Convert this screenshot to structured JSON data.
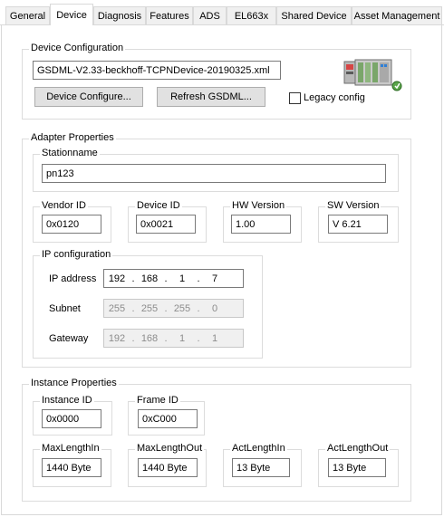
{
  "tabs": [
    {
      "label": "General"
    },
    {
      "label": "Device"
    },
    {
      "label": "Diagnosis"
    },
    {
      "label": "Features"
    },
    {
      "label": "ADS"
    },
    {
      "label": "EL663x"
    },
    {
      "label": "Shared Device"
    },
    {
      "label": "Asset Management"
    }
  ],
  "active_tab": "Device",
  "device_config": {
    "title": "Device Configuration",
    "gsdml_file": "GSDML-V2.33-beckhoff-TCPNDevice-20190325.xml",
    "device_configure_label": "Device Configure...",
    "refresh_gsdml_label": "Refresh GSDML...",
    "legacy_config_label": "Legacy config",
    "legacy_config_checked": false,
    "device_image_icon": "network-device-icon"
  },
  "adapter": {
    "title": "Adapter Properties",
    "stationname_label": "Stationname",
    "stationname": "pn123",
    "vendor_id_label": "Vendor ID",
    "vendor_id": "0x0120",
    "device_id_label": "Device ID",
    "device_id": "0x0021",
    "hw_version_label": "HW Version",
    "hw_version": "1.00",
    "sw_version_label": "SW Version",
    "sw_version": "V 6.21",
    "ip_config": {
      "title": "IP configuration",
      "ip_address_label": "IP address",
      "ip_address": [
        "192",
        "168",
        "1",
        "7"
      ],
      "subnet_label": "Subnet",
      "subnet": [
        "255",
        "255",
        "255",
        "0"
      ],
      "gateway_label": "Gateway",
      "gateway": [
        "192",
        "168",
        "1",
        "1"
      ]
    }
  },
  "instance": {
    "title": "Instance Properties",
    "instance_id_label": "Instance ID",
    "instance_id": "0x0000",
    "frame_id_label": "Frame ID",
    "frame_id": "0xC000",
    "max_length_in_label": "MaxLengthIn",
    "max_length_in": "1440 Byte",
    "max_length_out_label": "MaxLengthOut",
    "max_length_out": "1440 Byte",
    "act_length_in_label": "ActLengthIn",
    "act_length_in": "13 Byte",
    "act_length_out_label": "ActLengthOut",
    "act_length_out": "13 Byte"
  },
  "colors": {
    "tab_inactive_bg": "#f0f0f0",
    "border": "#d9d9d9",
    "button_bg": "#e1e1e1",
    "disabled_bg": "#f0f0f0"
  }
}
